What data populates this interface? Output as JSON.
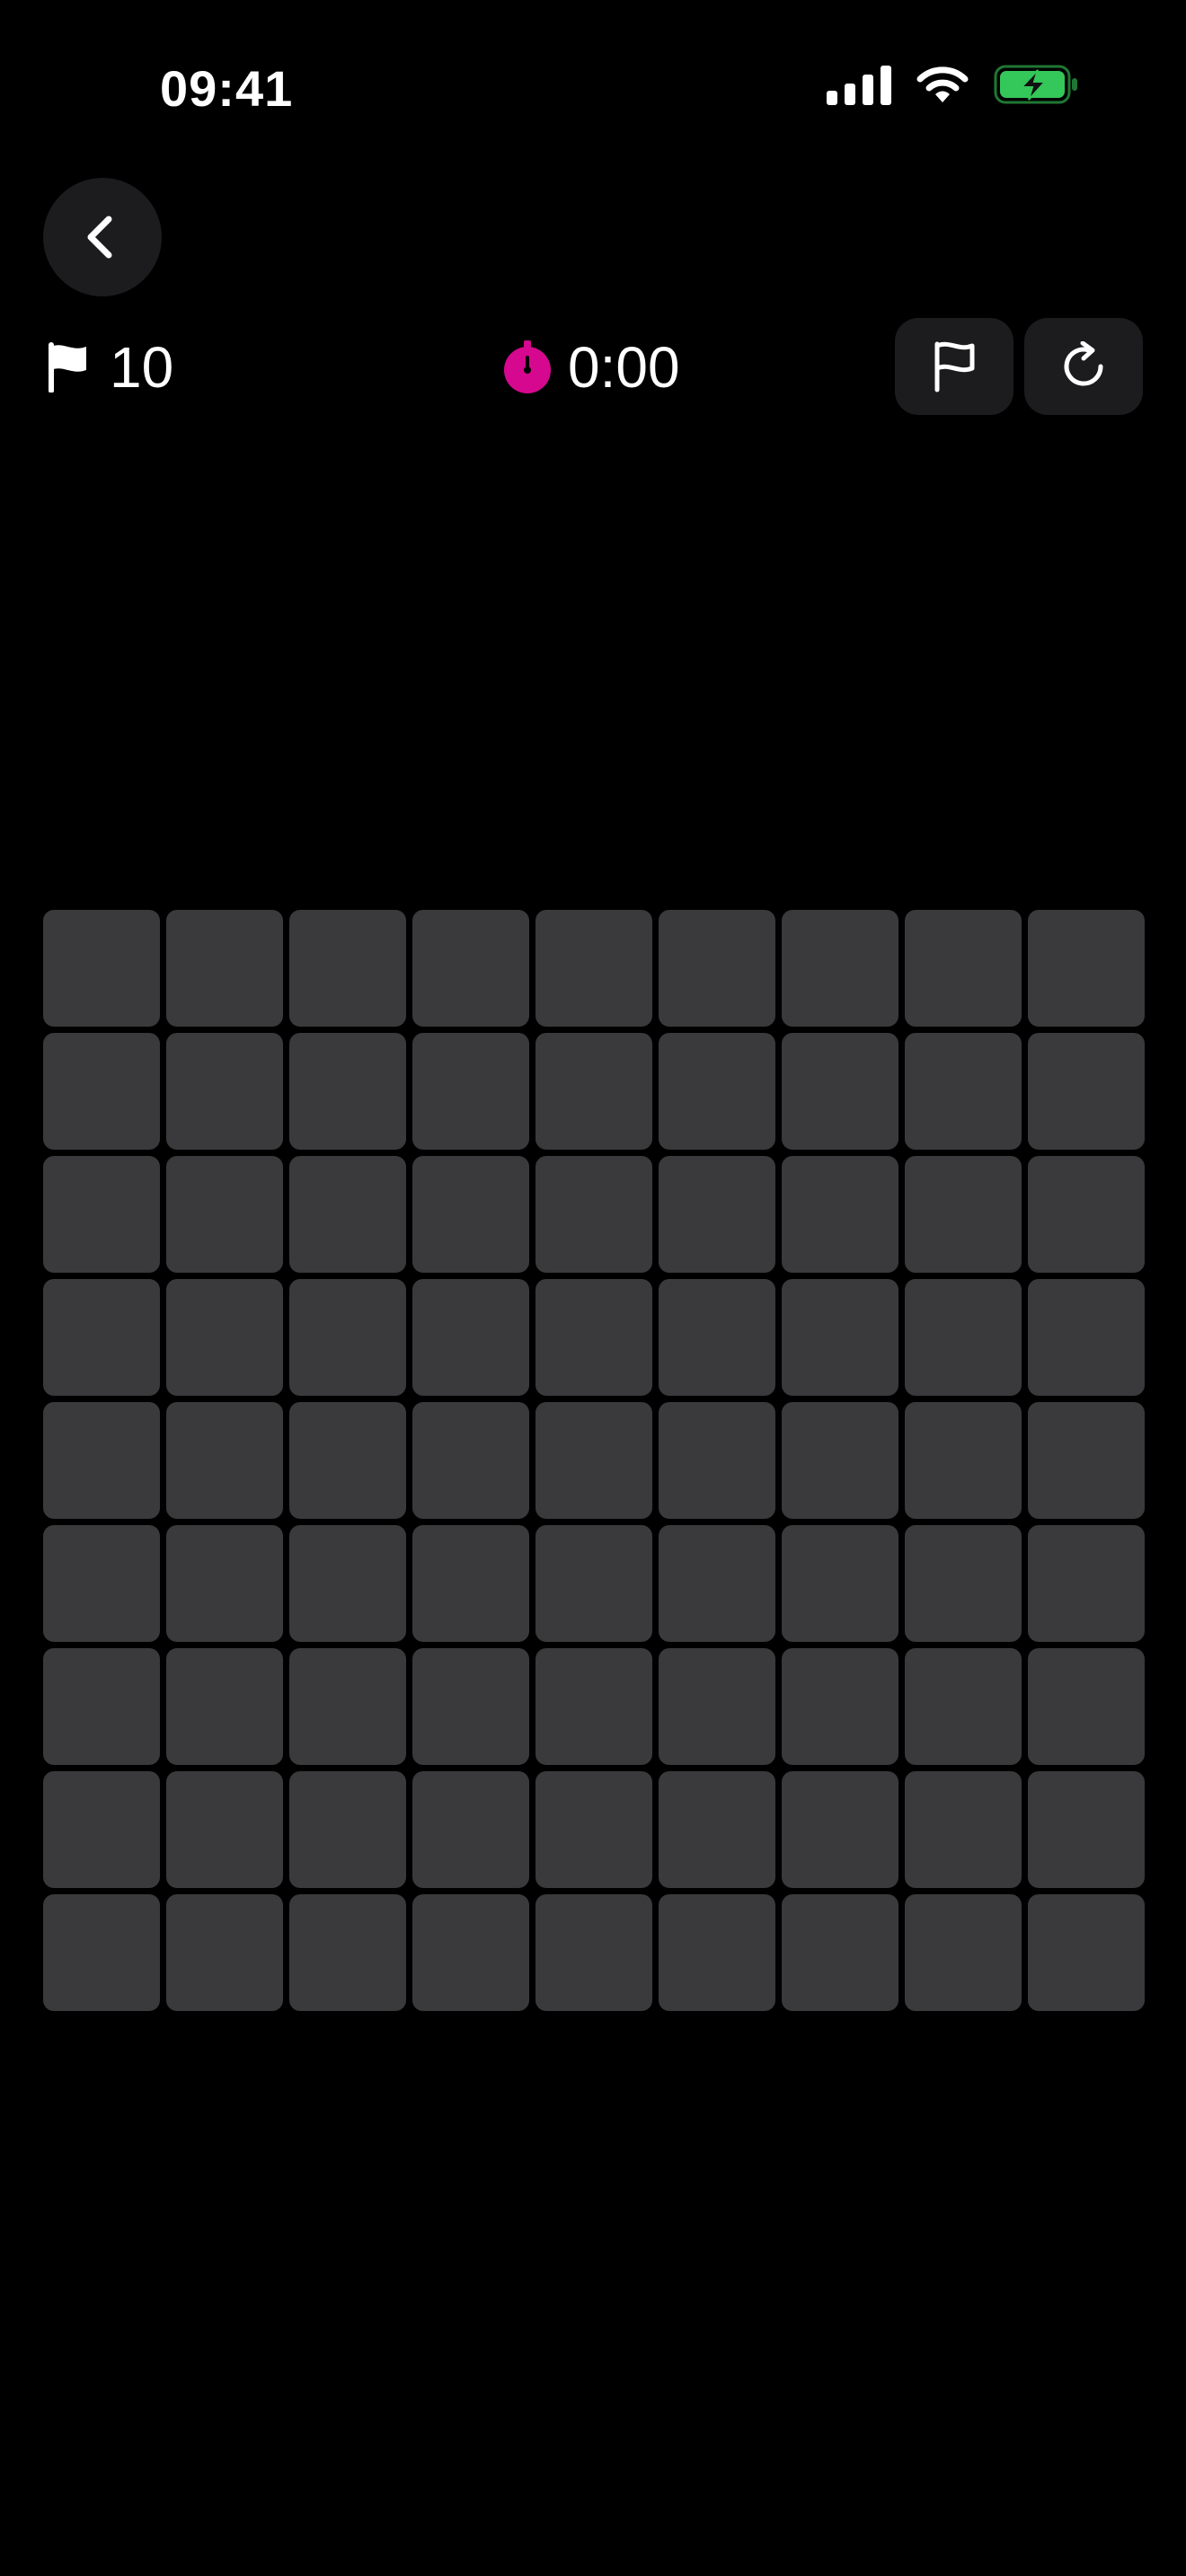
{
  "status_bar": {
    "time": "09:41",
    "icons": [
      "cellular-signal-icon",
      "wifi-icon",
      "battery-charging-icon"
    ],
    "battery_color": "#34c759"
  },
  "nav": {
    "back_icon": "chevron-left-icon"
  },
  "game": {
    "flags_remaining": "10",
    "flag_icon": "flag-filled-icon",
    "timer": "0:00",
    "timer_icon": "stopwatch-icon",
    "timer_color": "#d6088f",
    "flag_mode_icon": "flag-outline-icon",
    "restart_icon": "restart-icon"
  },
  "board": {
    "rows": 9,
    "columns": 9,
    "cell_state": "unrevealed",
    "cell_color": "#3a3a3c"
  }
}
